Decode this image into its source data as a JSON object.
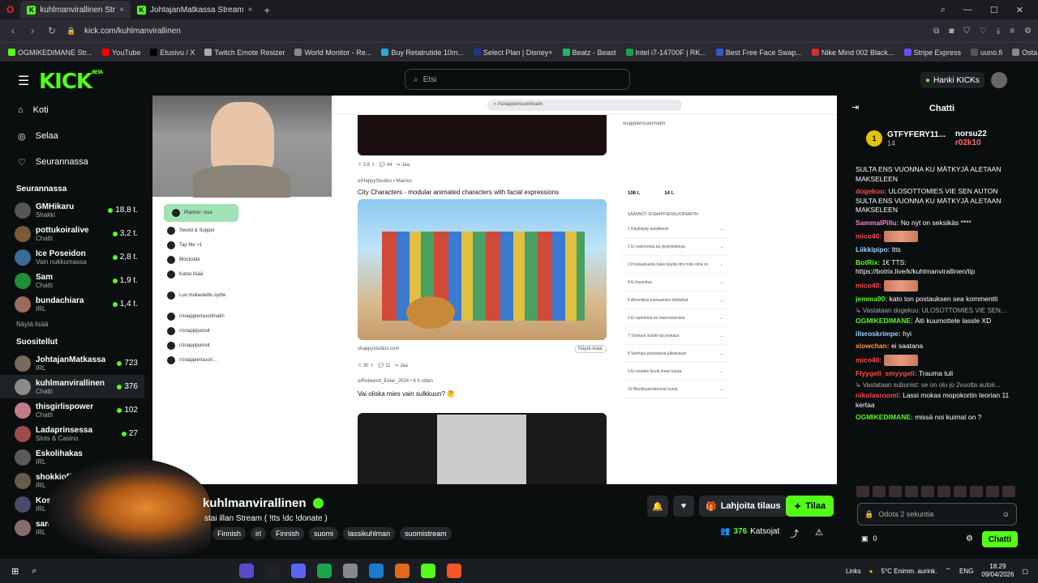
{
  "browser": {
    "tabs": [
      {
        "label": "kuhlmanvirallinen Str"
      },
      {
        "label": "JohtajanMatkassa Stream"
      }
    ],
    "url": "kick.com/kuhlmanvirallinen",
    "bookmarks": [
      "OGMIKEDIMANE Str...",
      "YouTube",
      "Etusivu / X",
      "Twitch Emote Resizer",
      "World Monitor - Re...",
      "Buy Retatrutide 10m...",
      "Select Plan | Disney+",
      "Beatz - Beast",
      "Intel i7-14700F | RK...",
      "Best Free Face Swap...",
      "Nike Mind 002 Black...",
      "Stripe Express",
      "uuno.fi",
      "Osta Retatrutides | T..."
    ],
    "bookmark_colors": [
      "#53fc18",
      "#ff0000",
      "#000000",
      "#aaaaaa",
      "#888888",
      "#2fa7d6",
      "#1a3a8f",
      "#26b26b",
      "#1aa34a",
      "#3358d6",
      "#d03030",
      "#6b4cf0",
      "#555555",
      "#888888"
    ]
  },
  "header": {
    "logo": "KICK",
    "logo_beta": "BETA",
    "search_placeholder": "Etsi",
    "kicks_label": "Hanki KICKs"
  },
  "sidebar": {
    "nav": [
      {
        "label": "Koti",
        "icon": "home-icon",
        "glyph": "⌂"
      },
      {
        "label": "Selaa",
        "icon": "compass-icon",
        "glyph": "◎"
      },
      {
        "label": "Seurannassa",
        "icon": "heart-icon",
        "glyph": "♡"
      }
    ],
    "following_title": "Seurannassa",
    "following": [
      {
        "name": "GMHikaru",
        "sub": "Shakki",
        "viewers": "18,8 t.",
        "color": "#555"
      },
      {
        "name": "pottukoiralive",
        "sub": "Chatti",
        "viewers": "3,2 t.",
        "color": "#7a5a3a"
      },
      {
        "name": "Ice Poseidon",
        "sub": "Vain nukkumassa",
        "viewers": "2,8 t.",
        "color": "#3a6a9a"
      },
      {
        "name": "Sam",
        "sub": "Chatti",
        "viewers": "1,9 t.",
        "color": "#1f8f3a"
      },
      {
        "name": "bundachiara",
        "sub": "IRL",
        "viewers": "1,4 t.",
        "color": "#9a6a5a"
      }
    ],
    "show_more": "Näytä lisää",
    "recommended_title": "Suositellut",
    "recommended": [
      {
        "name": "JohtajanMatkassa",
        "sub": "IRL",
        "viewers": "723",
        "color": "#7a6a5a"
      },
      {
        "name": "kuhlmanvirallinen",
        "sub": "Chatti",
        "viewers": "376",
        "color": "#8a8a8a"
      },
      {
        "name": "thisgirlispower",
        "sub": "Chatti",
        "viewers": "102",
        "color": "#c07a8a"
      },
      {
        "name": "Ladaprinsessa",
        "sub": "Slots & Casino",
        "viewers": "27",
        "color": "#a04a4a"
      },
      {
        "name": "Eskolihakas",
        "sub": "IRL",
        "viewers": "",
        "color": "#5a5a5a"
      },
      {
        "name": "shokkioff",
        "sub": "IRL",
        "viewers": "",
        "color": "#6a5a4a"
      },
      {
        "name": "Kossar",
        "sub": "IRL",
        "viewers": "",
        "color": "#4a4a6a"
      },
      {
        "name": "sara",
        "sub": "IRL",
        "viewers": "",
        "color": "#8a6a6a"
      }
    ]
  },
  "screen": {
    "left_tree": [
      "Planner: sisa",
      "Sword & Supper",
      "Tap Me +1",
      "Blockside",
      "Katso lisää",
      "Luo mukautettu syöte",
      "r/snappiensuorimatin",
      "r/snappijuonut",
      "r/snappijuonut",
      "r/snappiensuori..."
    ],
    "post1_author": "u/HappyStudios • Mainos",
    "post1_title": "City Characters - modular animated characters with facial expressions",
    "post1_link": "shappystudios.com",
    "post1_button": "Näytä lisää",
    "post2_author": "u/Rebeestt_Eelar_2024 • 6 h sitten",
    "post2_title": "Vai oliska mies vain sulkkuun? 🤔",
    "side_sub": "snappiensuorimatin",
    "side_stats": [
      "108 t.",
      "14 t."
    ],
    "rules_title": "SÄÄNNÖT R/SNAPPIENSUORIMATIN",
    "rules": [
      "Käyttäydy asiallisesti",
      "Ei mainontaa tai yksityistietoja",
      "Postauksesta tulee käydä ilmi mitä siinä on",
      "Ei kopioitua",
      "Aiheellisia postaamien kiellettyä",
      "Ei spämmiä tai mainostamista",
      "Toistuva sisältö tai postaus",
      "Vanhoja postauksia julkaistaan",
      "Ei muiden kuvia ilman lupaa",
      "Muokkaamattomat kuvat"
    ]
  },
  "stream": {
    "channel": "kuhlmanvirallinen",
    "title": "stai illan Stream ( !tts !dc !donate )",
    "tags": [
      "Finnish",
      "irl",
      "Finnish",
      "suomi",
      "lassikuhlman",
      "suomistream"
    ],
    "gift_label": "Lahjoita tilaus",
    "sub_label": "Tilaa",
    "viewers": "376",
    "viewers_label": "Katsojat"
  },
  "chat": {
    "title": "Chatti",
    "leaders": [
      {
        "name": "GTFYFERY11...",
        "sub": "14"
      },
      {
        "name": "norsu22",
        "sub": "1"
      },
      {
        "name": "r02k10",
        "sub": "1"
      }
    ],
    "messages": [
      {
        "user": "",
        "color": "#ffffff",
        "text": "SULTA ENS VUONNA KU MÄTKYJÄ ALETAAN MAKSELEEN"
      },
      {
        "user": "dogekuu:",
        "color": "#ff4a4a",
        "text": "ULOSOTTOMIES VIE SEN AUTON SULTA ENS VUONNA KU MÄTKYJÄ ALETAAN MAKSELEEN"
      },
      {
        "user": "SammalPillu:",
        "color": "#ff7ad0",
        "text": "No nyt on seksikäs ****"
      },
      {
        "user": "mico40:",
        "color": "#ff4a4a",
        "text": "",
        "emote": true
      },
      {
        "user": "Liikkipipo:",
        "color": "#9ad0ff",
        "text": "ltts"
      },
      {
        "user": "BotRix:",
        "color": "#53fc18",
        "text": "1€ TTS: https://botrix.live/k/kuhlmanvirallinen/tip"
      },
      {
        "user": "mico40:",
        "color": "#ff4a4a",
        "text": "",
        "emote": true
      },
      {
        "user": "jemma90:",
        "color": "#53fc18",
        "text": "kato ton postauksen sea kommentti"
      },
      {
        "sys": "Vastataan dogekuu: ULOSOTTOMIES VIE SEN..."
      },
      {
        "user": "OGMIKEDIMANE:",
        "color": "#53fc18",
        "text": "Äiti kuumottele lassle XD"
      },
      {
        "user": "illeroskrimpe:",
        "color": "#9ad0ff",
        "text": "hyi"
      },
      {
        "user": "slowchan:",
        "color": "#ff9a3a",
        "text": "ei saatana"
      },
      {
        "user": "mico40:",
        "color": "#ff4a4a",
        "text": "",
        "emote": true
      },
      {
        "user": "Flyygeli_smyygeli:",
        "color": "#ff4a4a",
        "text": "Trauma tuli"
      },
      {
        "sys": "Vastataan subunist: se on olu jo 2vuotta autok..."
      },
      {
        "user": "nikolasroomi:",
        "color": "#ff4a4a",
        "text": "Lassi mokas mopokortin teorian 11 kertaa"
      },
      {
        "user": "OGMIKEDIMANE:",
        "color": "#53fc18",
        "text": "missä noi kuimat on ?"
      }
    ],
    "input_placeholder": "Odota 2 sekuntia",
    "kick_count": "0",
    "send_label": "Chatti"
  },
  "taskbar": {
    "links": "Links",
    "weather": "5°C  Enimm. aurink.",
    "lang": "ENG",
    "time": "18.29",
    "date": "09/04/2026"
  }
}
